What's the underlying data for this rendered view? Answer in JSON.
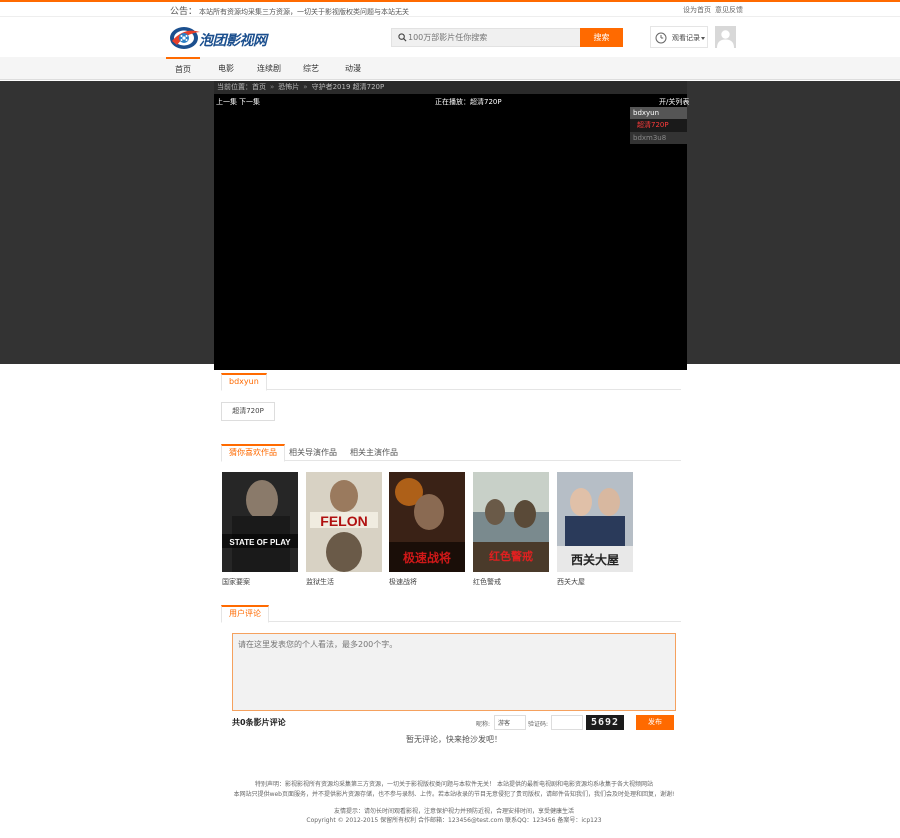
{
  "notice": {
    "label": "公告：",
    "text": "本站所有资源均采集三方资源，一切关于影视版权类问题与本站无关",
    "links": [
      "设为首页",
      "意见反馈"
    ]
  },
  "header": {
    "logo_text": "泡团影视网",
    "search_placeholder": "100万部影片任你搜索",
    "search_button": "搜索",
    "history_label": "观看记录"
  },
  "nav": [
    "首页",
    "电影",
    "连续剧",
    "综艺",
    "动漫"
  ],
  "breadcrumb": {
    "prefix": "当前位置：",
    "items": [
      "首页",
      "恐怖片",
      "守护者2019 超清720P"
    ],
    "separator": "»"
  },
  "player": {
    "prev_label": "上一集",
    "next_label": "下一集",
    "now_playing_label": "正在播放：",
    "now_playing_value": "超清720P",
    "toggle_list": "开/关列表",
    "sources": [
      {
        "name": "bdxyun",
        "episodes": [
          "超清720P"
        ]
      },
      {
        "name": "bdxm3u8"
      }
    ]
  },
  "episode_section": {
    "tab": "bdxyun",
    "episodes": [
      "超清720P"
    ]
  },
  "related": {
    "tabs": [
      "猜你喜欢作品",
      "相关导演作品",
      "相关主演作品"
    ],
    "movies": [
      {
        "title": "国家要案",
        "poster_text": "STATE OF PLAY",
        "bg": "#2b2b2b"
      },
      {
        "title": "监狱生活",
        "poster_text": "FELON",
        "bg": "#7a6a55"
      },
      {
        "title": "极速战将",
        "poster_text": "极速战将",
        "bg": "#4a2a1a"
      },
      {
        "title": "红色警戒",
        "poster_text": "红色警戒",
        "bg": "#5a6a6e"
      },
      {
        "title": "西关大屋",
        "poster_text": "西关大屋",
        "bg": "#9aa3ad"
      }
    ]
  },
  "comments": {
    "tab": "用户评论",
    "placeholder": "请在这里发表您的个人看法，最多200个字。",
    "count_text": "共0条影片评论",
    "nickname_label": "昵称:",
    "nickname_value": "游客",
    "captcha_label": "验证码:",
    "captcha_value": "5692",
    "publish": "发布",
    "empty_text": "暂无评论，快来抢沙发吧！"
  },
  "footer": {
    "lines": [
      "特别声明：影视影视所有资源均采集第三方资源，一切关于影视版权类问题与本软件无关！ 本站提供的最新电视剧和电影资源均系收集于各大视频网站",
      "本网站只提供web页面服务，并不提供影片资源存储，也不参与录制、上传。若本站收录的节目无意侵犯了贵司版权，请邮件告知我们，我们会及时处理和回复，谢谢!",
      "友情提示：请勿长时间观看影视，注意保护视力并预防近视，合理安排时间，享受健康生活",
      "Copyright © 2012-2015 保留所有权利 合作邮箱：123456@test.com 联系QQ：123456 备案号：icp123"
    ]
  },
  "colors": {
    "accent": "#ff6a00",
    "player_band": "#333333",
    "player_bg": "#000000"
  }
}
